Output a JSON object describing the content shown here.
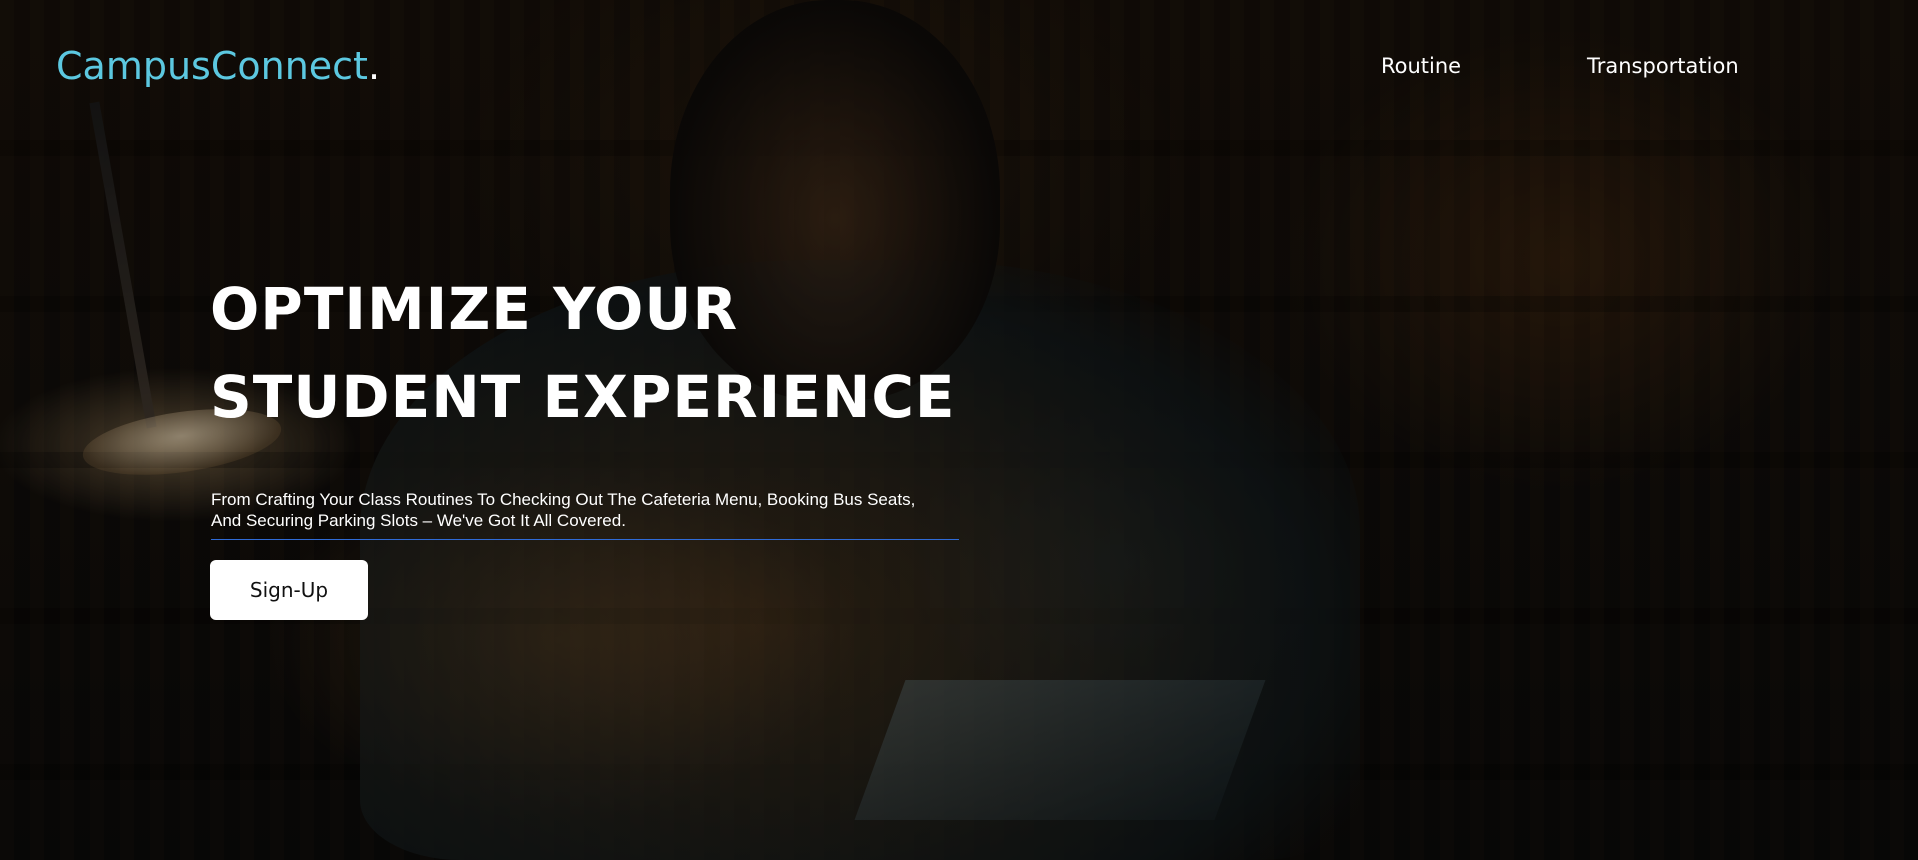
{
  "brand": {
    "name": "CampusConnect",
    "dot": ".",
    "color": "#5cc8e0"
  },
  "nav": {
    "items": [
      {
        "label": "Routine"
      },
      {
        "label": "Transportation"
      }
    ]
  },
  "hero": {
    "headline_line1": "OPTIMIZE YOUR",
    "headline_line2": "STUDENT EXPERIENCE",
    "subtext_line1": "From Crafting Your Class Routines To Checking Out The Cafeteria Menu, Booking Bus Seats,",
    "subtext_line2": "And Securing Parking Slots – We've Got It All Covered.",
    "cta_label": "Sign-Up",
    "underline_color": "#2f6bd6"
  }
}
